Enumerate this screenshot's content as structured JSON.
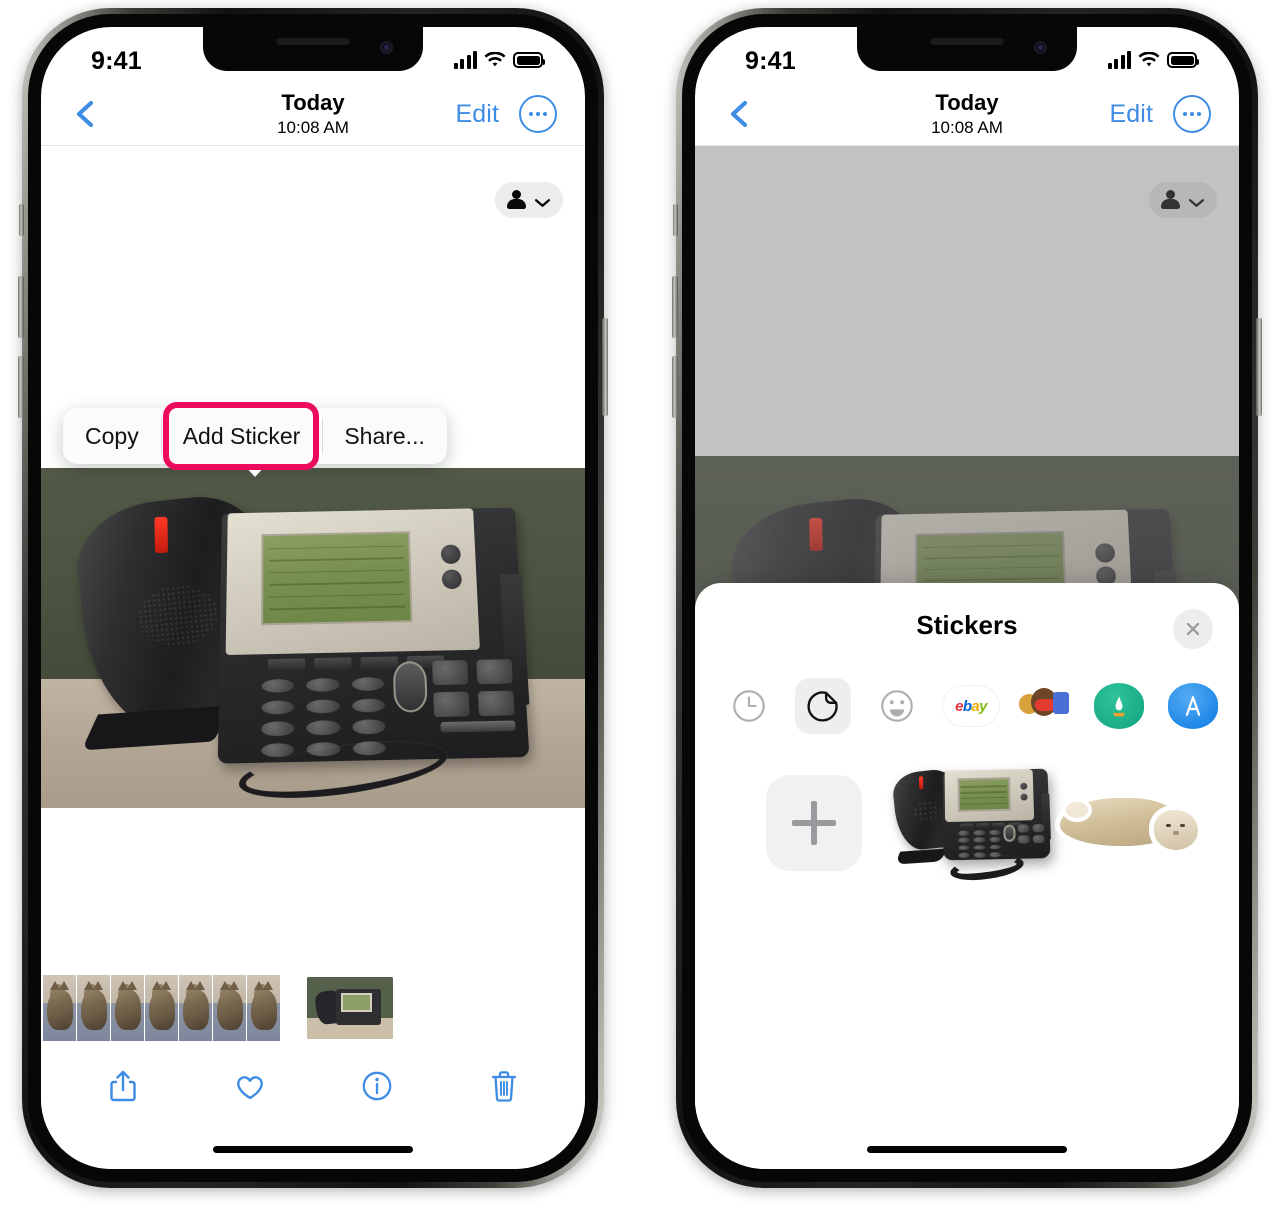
{
  "status_bar": {
    "time": "9:41",
    "cellular": "signal-bars",
    "wifi": "wifi-full",
    "battery": "battery-full"
  },
  "nav": {
    "back": "back-chevron",
    "title": "Today",
    "subtitle": "10:08 AM",
    "edit_label": "Edit",
    "more_label": "more-options"
  },
  "people_pill": {
    "icon": "person-icon",
    "chevron": "chevron-down-icon"
  },
  "left_phone": {
    "context_menu": {
      "items": [
        {
          "label": "Copy",
          "highlighted": false
        },
        {
          "label": "Add Sticker",
          "highlighted": true
        },
        {
          "label": "Share...",
          "highlighted": false
        }
      ],
      "highlight_color": "#ec0b5c"
    },
    "photo_alt": "desk-voip-phone-photo",
    "filmstrip": {
      "thumbs": [
        "cat",
        "cat",
        "cat",
        "cat",
        "cat",
        "cat",
        "cat"
      ],
      "selected_thumb": "desk-phone"
    },
    "toolbar": [
      {
        "name": "share-button",
        "icon": "share-icon"
      },
      {
        "name": "favorite-button",
        "icon": "heart-icon"
      },
      {
        "name": "info-button",
        "icon": "info-icon"
      },
      {
        "name": "delete-button",
        "icon": "trash-icon"
      }
    ],
    "accent_color": "#3e8ce4"
  },
  "right_phone": {
    "dimmed": true,
    "sticker_sheet": {
      "title": "Stickers",
      "close_label": "close-sheet",
      "categories": [
        {
          "name": "recents",
          "icon": "clock-icon",
          "active": false
        },
        {
          "name": "stickers",
          "icon": "sticker-peel-icon",
          "active": true
        },
        {
          "name": "emoji",
          "icon": "smiley-icon",
          "active": false
        },
        {
          "name": "ebay",
          "icon": "ebay-logo",
          "active": false,
          "text": "ebay"
        },
        {
          "name": "memoji-pack",
          "icon": "memoji-icon",
          "active": false
        },
        {
          "name": "app-pack-teal",
          "icon": "app-teal-icon",
          "active": false
        },
        {
          "name": "app-store",
          "icon": "app-store-icon",
          "active": false
        }
      ],
      "grid": [
        {
          "name": "add-sticker-tile",
          "icon": "plus-icon"
        },
        {
          "name": "desk-phone-sticker",
          "icon": "desk-phone-sticker"
        },
        {
          "name": "cat-sticker",
          "icon": "cat-sticker"
        }
      ]
    }
  }
}
